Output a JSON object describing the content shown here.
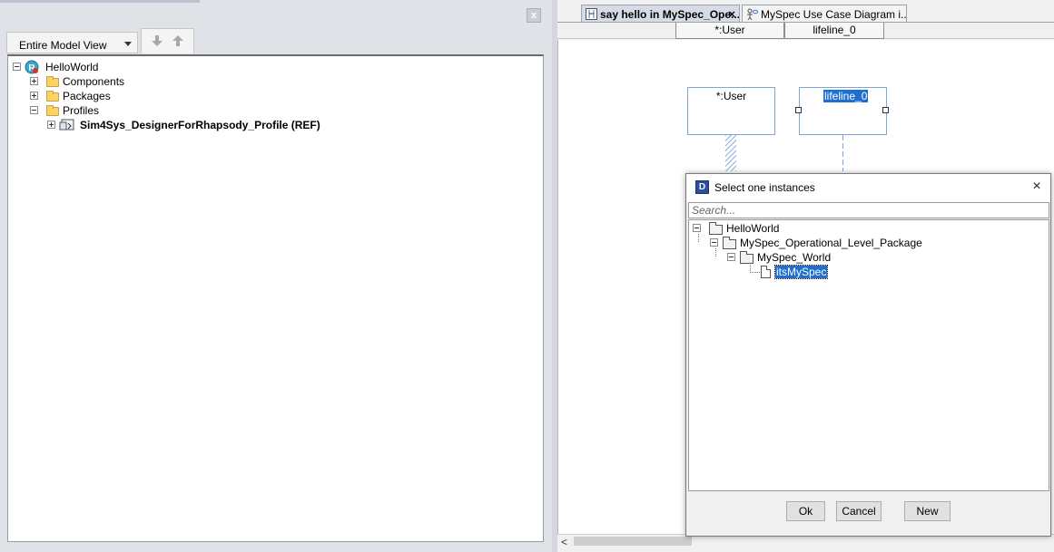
{
  "browser": {
    "close_label": "x",
    "view_selector": {
      "selected": "Entire Model View"
    },
    "tree": {
      "root": "HelloWorld",
      "components": "Components",
      "packages": "Packages",
      "profiles": "Profiles",
      "profile_ref": "Sim4Sys_DesignerForRhapsody_Profile (REF)"
    }
  },
  "editor": {
    "tabs": [
      {
        "label": "say hello in MySpec_Ope...",
        "close": "×"
      },
      {
        "label": "MySpec Use Case Diagram i..."
      }
    ],
    "lifeline_headers": [
      "*:User",
      "lifeline_0"
    ],
    "lifelines": [
      {
        "name": "*:User"
      },
      {
        "name": "lifeline_0"
      }
    ],
    "scroll_left": "<"
  },
  "dialog": {
    "icon_letter": "D",
    "title": "Select one instances",
    "close": "×",
    "search_placeholder": "Search...",
    "tree": {
      "root": "HelloWorld",
      "package": "MySpec_Operational_Level_Package",
      "world": "MySpec_World",
      "instance": "itsMySpec"
    },
    "buttons": {
      "ok": "Ok",
      "cancel": "Cancel",
      "new": "New"
    }
  },
  "colors": {
    "selection": "#1e6fd1",
    "lifeline_border": "#7ea6d6",
    "folder": "#f7d36a",
    "pane_bg": "#dfe3e8"
  }
}
